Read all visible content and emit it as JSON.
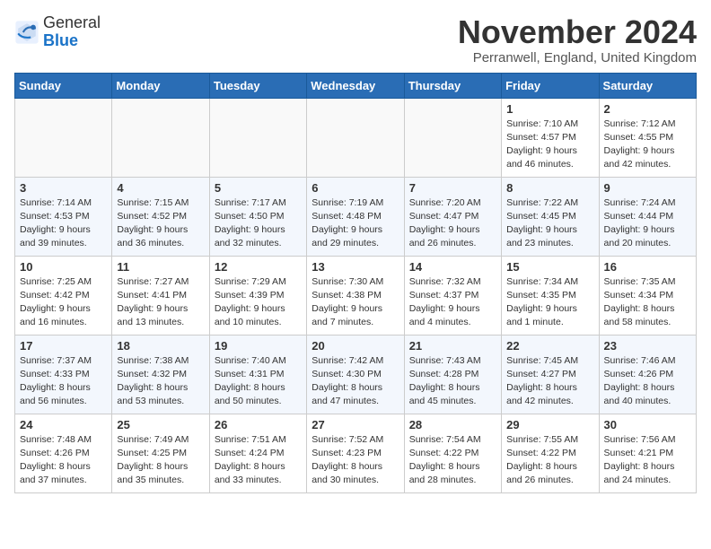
{
  "header": {
    "logo_line1": "General",
    "logo_line2": "Blue",
    "month": "November 2024",
    "location": "Perranwell, England, United Kingdom"
  },
  "weekdays": [
    "Sunday",
    "Monday",
    "Tuesday",
    "Wednesday",
    "Thursday",
    "Friday",
    "Saturday"
  ],
  "weeks": [
    [
      {
        "day": "",
        "info": ""
      },
      {
        "day": "",
        "info": ""
      },
      {
        "day": "",
        "info": ""
      },
      {
        "day": "",
        "info": ""
      },
      {
        "day": "",
        "info": ""
      },
      {
        "day": "1",
        "info": "Sunrise: 7:10 AM\nSunset: 4:57 PM\nDaylight: 9 hours\nand 46 minutes."
      },
      {
        "day": "2",
        "info": "Sunrise: 7:12 AM\nSunset: 4:55 PM\nDaylight: 9 hours\nand 42 minutes."
      }
    ],
    [
      {
        "day": "3",
        "info": "Sunrise: 7:14 AM\nSunset: 4:53 PM\nDaylight: 9 hours\nand 39 minutes."
      },
      {
        "day": "4",
        "info": "Sunrise: 7:15 AM\nSunset: 4:52 PM\nDaylight: 9 hours\nand 36 minutes."
      },
      {
        "day": "5",
        "info": "Sunrise: 7:17 AM\nSunset: 4:50 PM\nDaylight: 9 hours\nand 32 minutes."
      },
      {
        "day": "6",
        "info": "Sunrise: 7:19 AM\nSunset: 4:48 PM\nDaylight: 9 hours\nand 29 minutes."
      },
      {
        "day": "7",
        "info": "Sunrise: 7:20 AM\nSunset: 4:47 PM\nDaylight: 9 hours\nand 26 minutes."
      },
      {
        "day": "8",
        "info": "Sunrise: 7:22 AM\nSunset: 4:45 PM\nDaylight: 9 hours\nand 23 minutes."
      },
      {
        "day": "9",
        "info": "Sunrise: 7:24 AM\nSunset: 4:44 PM\nDaylight: 9 hours\nand 20 minutes."
      }
    ],
    [
      {
        "day": "10",
        "info": "Sunrise: 7:25 AM\nSunset: 4:42 PM\nDaylight: 9 hours\nand 16 minutes."
      },
      {
        "day": "11",
        "info": "Sunrise: 7:27 AM\nSunset: 4:41 PM\nDaylight: 9 hours\nand 13 minutes."
      },
      {
        "day": "12",
        "info": "Sunrise: 7:29 AM\nSunset: 4:39 PM\nDaylight: 9 hours\nand 10 minutes."
      },
      {
        "day": "13",
        "info": "Sunrise: 7:30 AM\nSunset: 4:38 PM\nDaylight: 9 hours\nand 7 minutes."
      },
      {
        "day": "14",
        "info": "Sunrise: 7:32 AM\nSunset: 4:37 PM\nDaylight: 9 hours\nand 4 minutes."
      },
      {
        "day": "15",
        "info": "Sunrise: 7:34 AM\nSunset: 4:35 PM\nDaylight: 9 hours\nand 1 minute."
      },
      {
        "day": "16",
        "info": "Sunrise: 7:35 AM\nSunset: 4:34 PM\nDaylight: 8 hours\nand 58 minutes."
      }
    ],
    [
      {
        "day": "17",
        "info": "Sunrise: 7:37 AM\nSunset: 4:33 PM\nDaylight: 8 hours\nand 56 minutes."
      },
      {
        "day": "18",
        "info": "Sunrise: 7:38 AM\nSunset: 4:32 PM\nDaylight: 8 hours\nand 53 minutes."
      },
      {
        "day": "19",
        "info": "Sunrise: 7:40 AM\nSunset: 4:31 PM\nDaylight: 8 hours\nand 50 minutes."
      },
      {
        "day": "20",
        "info": "Sunrise: 7:42 AM\nSunset: 4:30 PM\nDaylight: 8 hours\nand 47 minutes."
      },
      {
        "day": "21",
        "info": "Sunrise: 7:43 AM\nSunset: 4:28 PM\nDaylight: 8 hours\nand 45 minutes."
      },
      {
        "day": "22",
        "info": "Sunrise: 7:45 AM\nSunset: 4:27 PM\nDaylight: 8 hours\nand 42 minutes."
      },
      {
        "day": "23",
        "info": "Sunrise: 7:46 AM\nSunset: 4:26 PM\nDaylight: 8 hours\nand 40 minutes."
      }
    ],
    [
      {
        "day": "24",
        "info": "Sunrise: 7:48 AM\nSunset: 4:26 PM\nDaylight: 8 hours\nand 37 minutes."
      },
      {
        "day": "25",
        "info": "Sunrise: 7:49 AM\nSunset: 4:25 PM\nDaylight: 8 hours\nand 35 minutes."
      },
      {
        "day": "26",
        "info": "Sunrise: 7:51 AM\nSunset: 4:24 PM\nDaylight: 8 hours\nand 33 minutes."
      },
      {
        "day": "27",
        "info": "Sunrise: 7:52 AM\nSunset: 4:23 PM\nDaylight: 8 hours\nand 30 minutes."
      },
      {
        "day": "28",
        "info": "Sunrise: 7:54 AM\nSunset: 4:22 PM\nDaylight: 8 hours\nand 28 minutes."
      },
      {
        "day": "29",
        "info": "Sunrise: 7:55 AM\nSunset: 4:22 PM\nDaylight: 8 hours\nand 26 minutes."
      },
      {
        "day": "30",
        "info": "Sunrise: 7:56 AM\nSunset: 4:21 PM\nDaylight: 8 hours\nand 24 minutes."
      }
    ]
  ]
}
